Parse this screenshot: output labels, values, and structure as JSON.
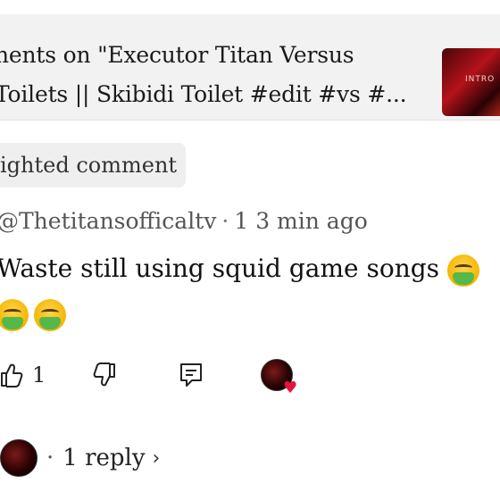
{
  "header": {
    "title_line1": "nents on \"Executor Titan Versus",
    "title_line2": "Toilets || Skibidi Toilet #edit #vs #...",
    "thumbnail_text": "INTRO",
    "thumbnail_color": "#b3121a"
  },
  "chip": {
    "label": "ighted comment"
  },
  "comment": {
    "author": "@Thetitansofficaltv",
    "edited_marker": "1",
    "time": "3  min ago",
    "text": "Waste still using squid game songs",
    "emoji": "face-vomiting-icon"
  },
  "actions": {
    "like_count": "1",
    "heart_color": "#e5133a"
  },
  "replies": {
    "label": "1  reply"
  }
}
